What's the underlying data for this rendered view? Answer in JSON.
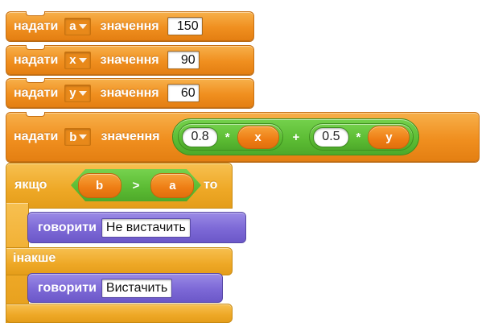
{
  "blocks": {
    "set_a": {
      "keyword": "надати",
      "variable": "a",
      "value_keyword": "значення",
      "value": "150"
    },
    "set_x": {
      "keyword": "надати",
      "variable": "x",
      "value_keyword": "значення",
      "value": "90"
    },
    "set_y": {
      "keyword": "надати",
      "variable": "y",
      "value_keyword": "значення",
      "value": "60"
    },
    "set_b": {
      "keyword": "надати",
      "variable": "b",
      "value_keyword": "значення",
      "expr": {
        "left": {
          "literal": "0.8",
          "op": "*",
          "var": "x"
        },
        "op": "+",
        "right": {
          "literal": "0.5",
          "op": "*",
          "var": "y"
        }
      }
    },
    "if_else": {
      "if_keyword": "якщо",
      "condition": {
        "left": "b",
        "op": ">",
        "right": "a"
      },
      "then_keyword": "то",
      "else_keyword": "інакше",
      "then_say": {
        "keyword": "говорити",
        "text": "Не вистачить"
      },
      "else_say": {
        "keyword": "говорити",
        "text": "Вистачить"
      }
    }
  },
  "colors": {
    "data_block": "#f08f1f",
    "operator": "#5bbb33",
    "control": "#eea826",
    "looks": "#7c68d6"
  }
}
